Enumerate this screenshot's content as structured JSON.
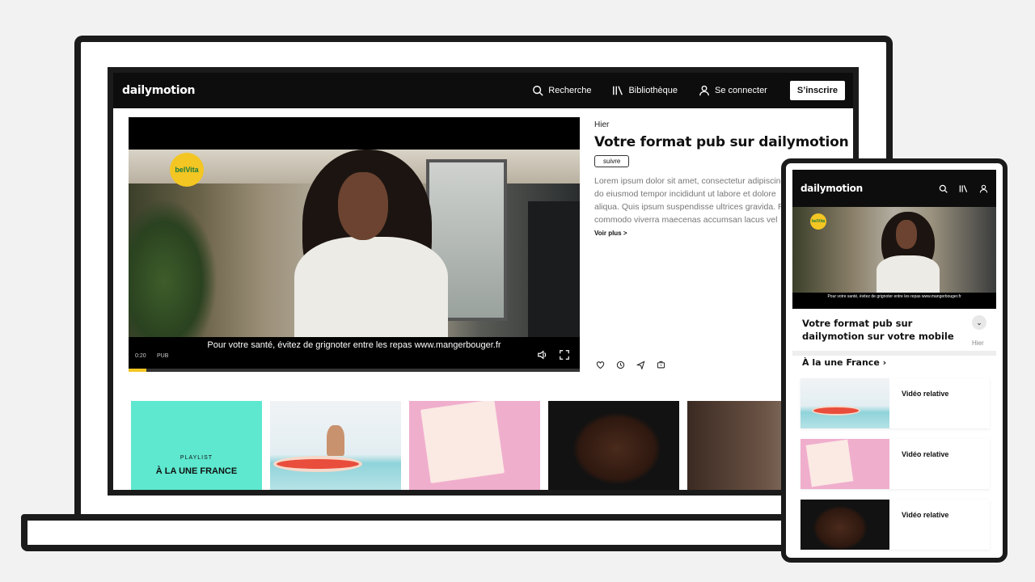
{
  "desktop": {
    "logo": "dailymotion",
    "nav": {
      "search_label": "Recherche",
      "library_label": "Bibliothèque",
      "login_label": "Se connecter",
      "signup_label": "S’inscrire"
    },
    "player": {
      "brand_logo": "belVita",
      "subtitle": "Pour votre santé, évitez de grignoter entre les repas www.mangerbouger.fr",
      "time": "0:20",
      "ad_label": "PUB",
      "progress": 0.04
    },
    "video": {
      "date": "Hier",
      "title": "Votre format pub sur dailymotion",
      "follow_label": "suivre",
      "description": [
        "Lorem ipsum dolor sit amet, consectetur adipiscing",
        "do eiusmod tempor incididunt ut labore et dolore",
        "aliqua. Quis ipsum suspendisse ultrices gravida. R",
        "commodo viverra maecenas accumsan lacus vel"
      ],
      "more_label": "Voir plus >",
      "actions": [
        "heart-icon",
        "clock-icon",
        "share-icon",
        "add-to-queue-icon"
      ]
    },
    "thumbnails": {
      "playlist_label": "PLAYLIST",
      "playlist_title": "À LA UNE FRANCE"
    }
  },
  "mobile": {
    "logo": "dailymotion",
    "brand_logo": "belVita",
    "subtitle": "Pour votre santé, évitez de grignoter entre les repas www.mangerbouger.fr",
    "title": "Votre format pub sur dailymotion sur votre mobile",
    "date": "Hier",
    "section_title": "À la une France ›",
    "related": [
      "Vidéo relative",
      "Vidéo relative",
      "Vidéo relative"
    ]
  }
}
